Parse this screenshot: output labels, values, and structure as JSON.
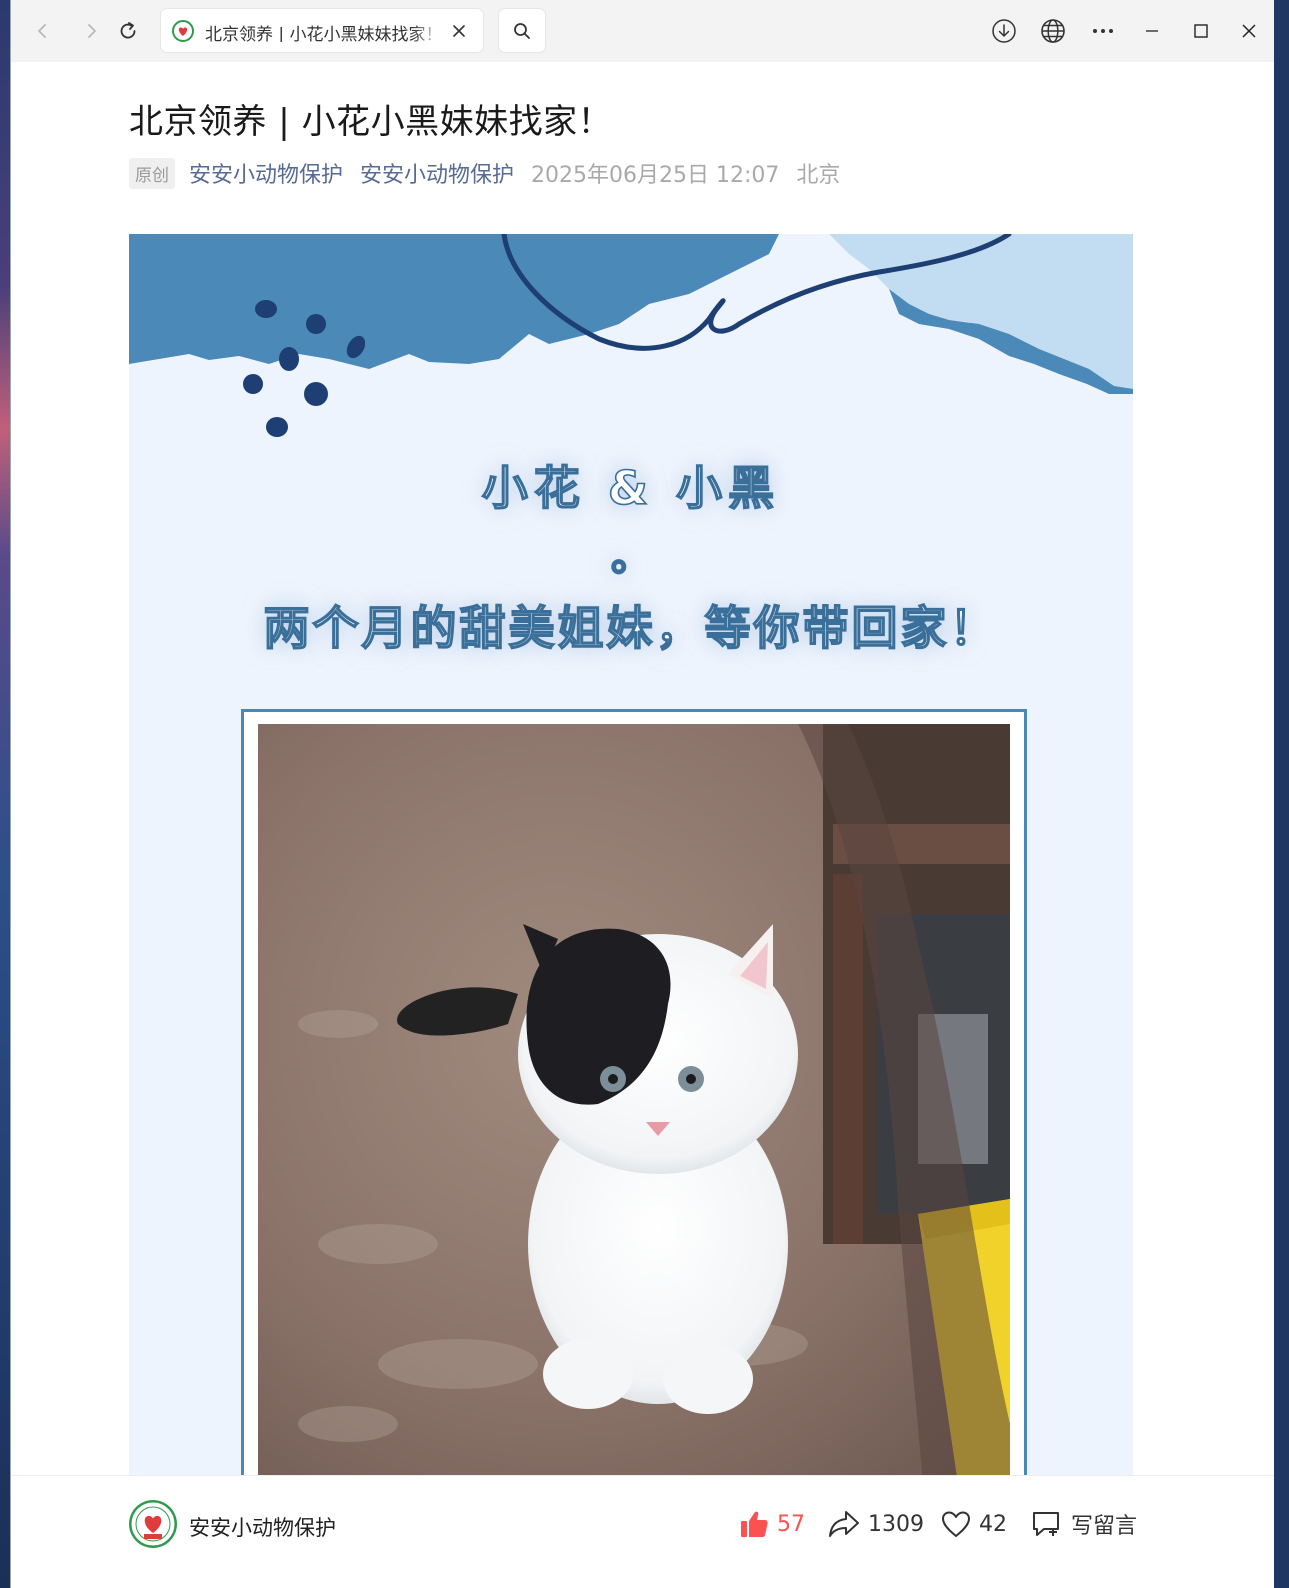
{
  "browser": {
    "tab_title": "北京领养 | 小花小黑妹妹找家！",
    "icons": [
      "back-icon",
      "forward-icon",
      "refresh-icon",
      "search-icon",
      "download-icon",
      "globe-icon",
      "more-icon",
      "minimize-icon",
      "maximize-icon",
      "close-icon"
    ]
  },
  "article": {
    "title": "北京领养 | 小花小黑妹妹找家！",
    "badge": "原创",
    "author": "安安小动物保护",
    "account": "安安小动物保护",
    "datetime": "2025年06月25日 12:07",
    "location": "北京"
  },
  "banner": {
    "names": "小花 & 小黑",
    "dot": "。",
    "subtitle": "两个月的甜美姐妹，等你带回家！",
    "colors": {
      "background": "#eef4fd",
      "accent": "#4a86b6",
      "stroke": "#1d3f73"
    }
  },
  "footer": {
    "account_name": "安安小动物保护",
    "like_count": "57",
    "share_count": "1309",
    "heart_count": "42",
    "comment_label": "写留言",
    "colors": {
      "like": "#fa5151"
    }
  }
}
